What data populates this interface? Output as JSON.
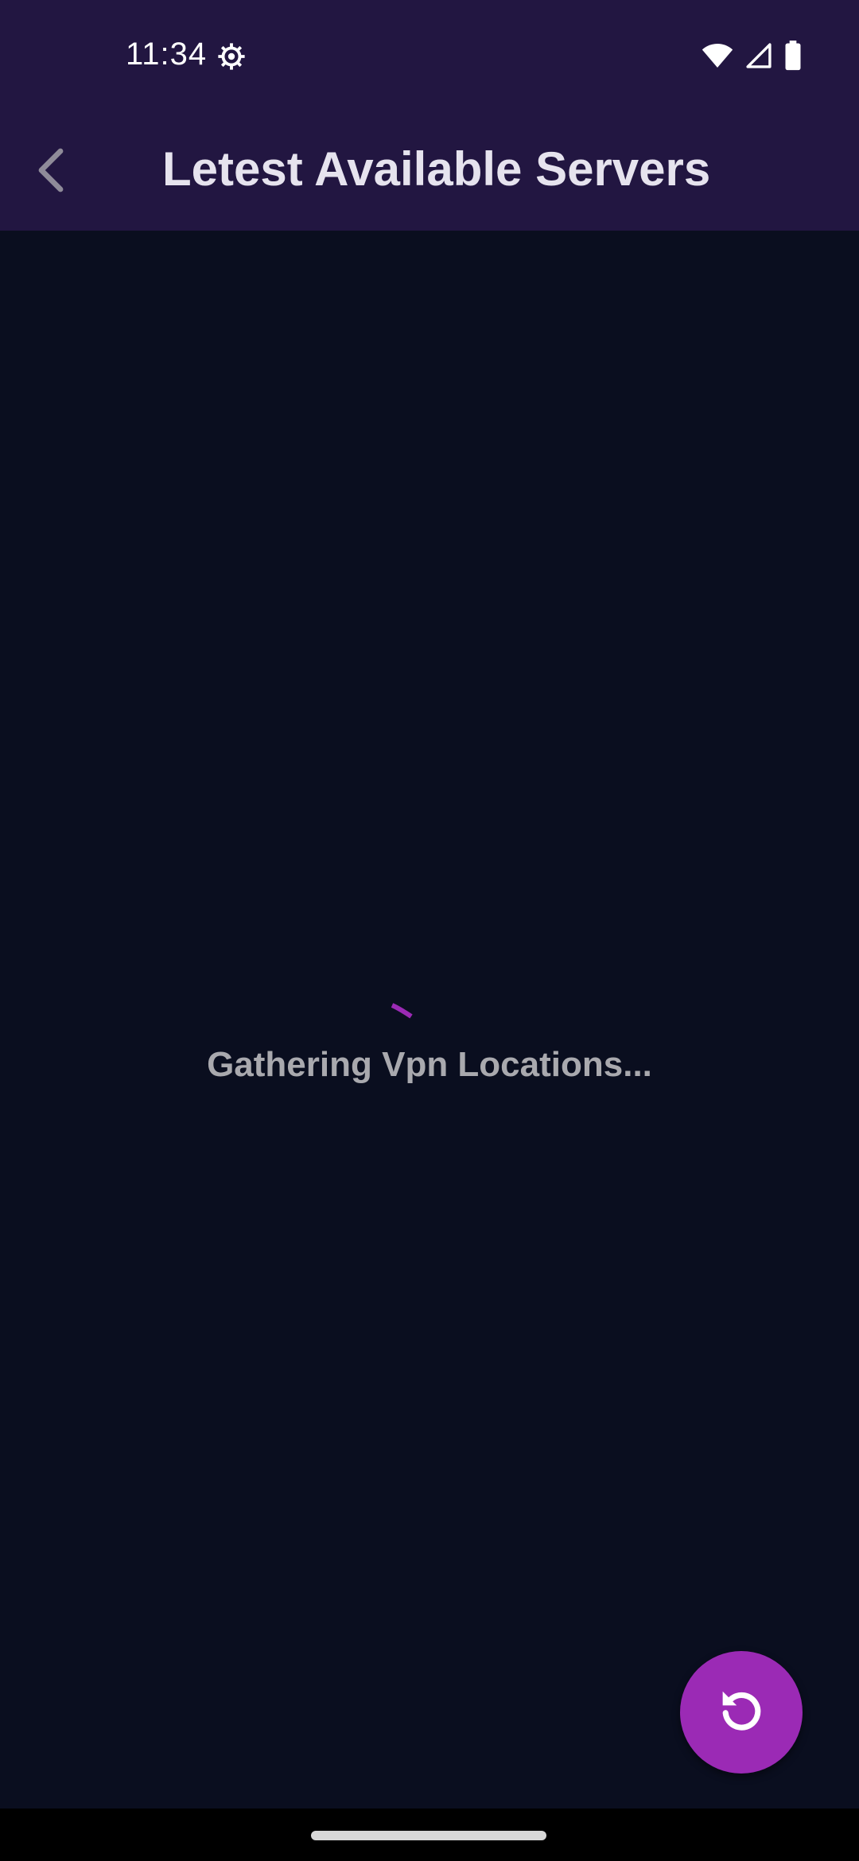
{
  "status_bar": {
    "time": "11:34",
    "icons": [
      "gear-icon",
      "wifi-icon",
      "signal-icon",
      "battery-icon"
    ]
  },
  "app_bar": {
    "title": "Letest Available Servers",
    "back_icon": "chevron-left-icon",
    "background": "#221641"
  },
  "main": {
    "loading_text": "Gathering Vpn Locations...",
    "background": "#0a0e1f",
    "spinner_color": "#9b2ab5"
  },
  "fab": {
    "icon": "refresh-icon",
    "color": "#9b2ab5"
  }
}
